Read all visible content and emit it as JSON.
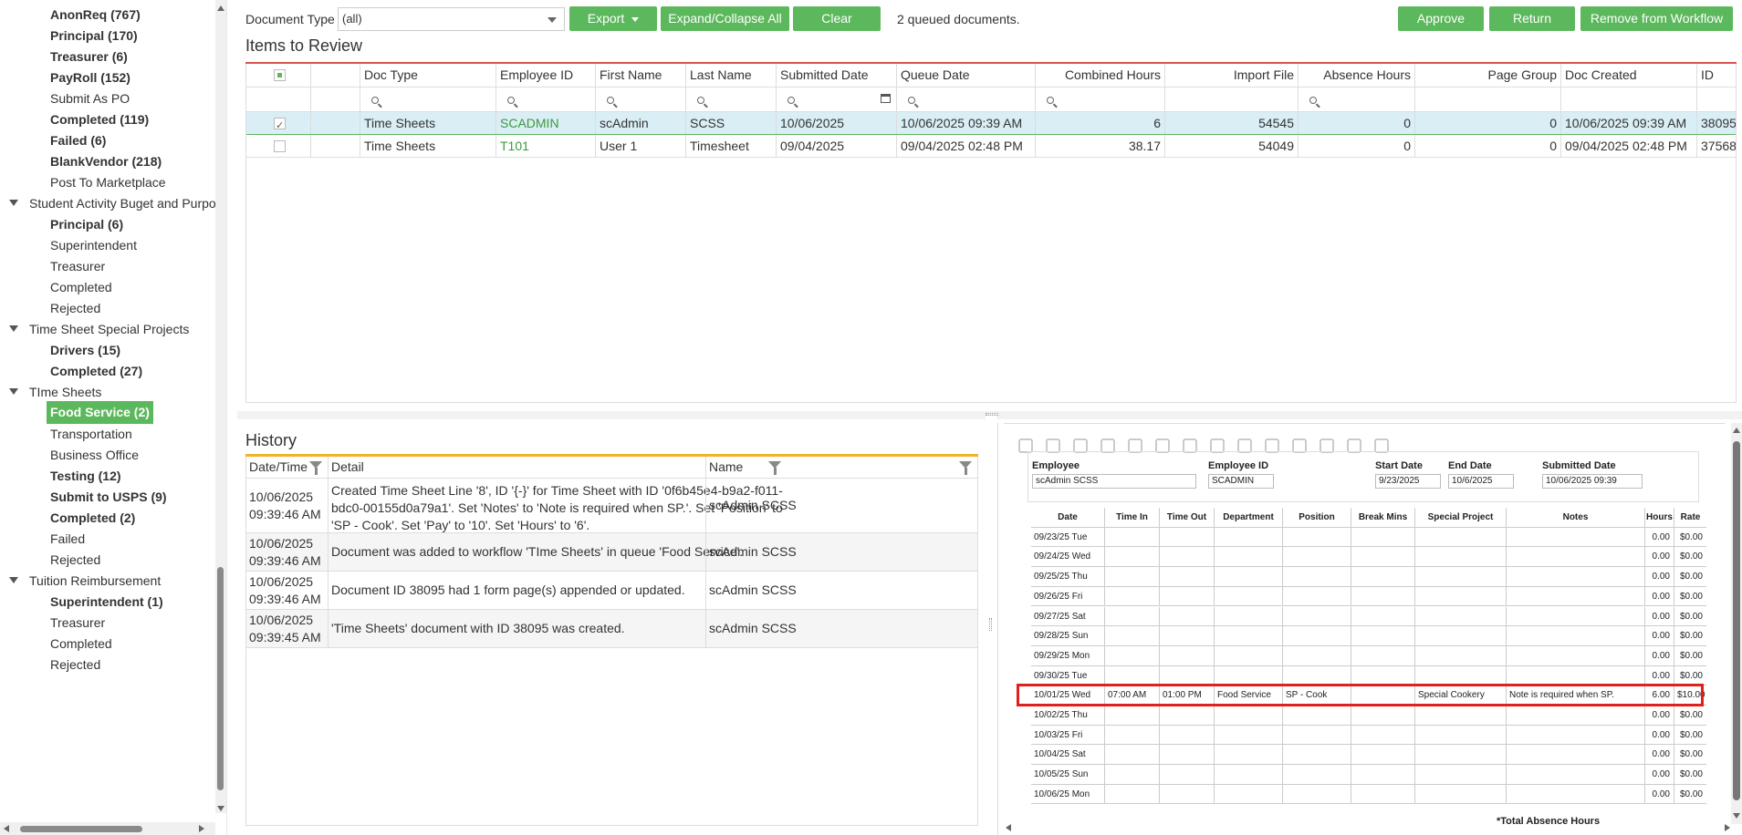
{
  "sidebar": {
    "items": [
      {
        "label": "AnonReq (767)",
        "level": 2,
        "bold": true
      },
      {
        "label": "Principal (170)",
        "level": 2,
        "bold": true
      },
      {
        "label": "Treasurer (6)",
        "level": 2,
        "bold": true
      },
      {
        "label": "PayRoll (152)",
        "level": 2,
        "bold": true
      },
      {
        "label": "Submit As PO",
        "level": 2,
        "bold": false
      },
      {
        "label": "Completed (119)",
        "level": 2,
        "bold": true
      },
      {
        "label": "Failed (6)",
        "level": 2,
        "bold": true
      },
      {
        "label": "BlankVendor (218)",
        "level": 2,
        "bold": true
      },
      {
        "label": "Post To Marketplace",
        "level": 2,
        "bold": false
      },
      {
        "label": "Student Activity Buget and Purpo",
        "level": 1,
        "bold": false
      },
      {
        "label": "Principal (6)",
        "level": 2,
        "bold": true
      },
      {
        "label": "Superintendent",
        "level": 2,
        "bold": false
      },
      {
        "label": "Treasurer",
        "level": 2,
        "bold": false
      },
      {
        "label": "Completed",
        "level": 2,
        "bold": false
      },
      {
        "label": "Rejected",
        "level": 2,
        "bold": false
      },
      {
        "label": "Time Sheet Special Projects",
        "level": 1,
        "bold": false
      },
      {
        "label": "Drivers (15)",
        "level": 2,
        "bold": true
      },
      {
        "label": "Completed (27)",
        "level": 2,
        "bold": true
      },
      {
        "label": "TIme Sheets",
        "level": 1,
        "bold": false
      },
      {
        "label": "Food Service (2)",
        "level": 2,
        "bold": true,
        "selected": true
      },
      {
        "label": "Transportation",
        "level": 2,
        "bold": false
      },
      {
        "label": "Business Office",
        "level": 2,
        "bold": false
      },
      {
        "label": "Testing (12)",
        "level": 2,
        "bold": true
      },
      {
        "label": "Submit to USPS (9)",
        "level": 2,
        "bold": true
      },
      {
        "label": "Completed (2)",
        "level": 2,
        "bold": true
      },
      {
        "label": "Failed",
        "level": 2,
        "bold": false
      },
      {
        "label": "Rejected",
        "level": 2,
        "bold": false
      },
      {
        "label": "Tuition Reimbursement",
        "level": 1,
        "bold": false
      },
      {
        "label": "Superintendent (1)",
        "level": 2,
        "bold": true
      },
      {
        "label": "Treasurer",
        "level": 2,
        "bold": false
      },
      {
        "label": "Completed",
        "level": 2,
        "bold": false
      },
      {
        "label": "Rejected",
        "level": 2,
        "bold": false
      }
    ]
  },
  "toolbar": {
    "doc_type_label": "Document Type",
    "doc_type_value": "(all)",
    "export_label": "Export",
    "expand_label": "Expand/Collapse All",
    "clear_label": "Clear",
    "queued_text": "2 queued documents.",
    "approve_label": "Approve",
    "return_label": "Return",
    "remove_label": "Remove from Workflow"
  },
  "items": {
    "title": "Items to Review",
    "columns": [
      "Doc Type",
      "Employee ID",
      "First Name",
      "Last Name",
      "Submitted Date",
      "Queue Date",
      "Combined Hours",
      "Import File",
      "Absence Hours",
      "Page Group",
      "Doc Created",
      "ID"
    ],
    "rows": [
      [
        "Time Sheets",
        "SCADMIN",
        "scAdmin",
        "SCSS",
        "10/06/2025",
        "10/06/2025 09:39 AM",
        "6",
        "54545",
        "0",
        "0",
        "10/06/2025 09:39 AM",
        "38095"
      ],
      [
        "Time Sheets",
        "T101",
        "User 1",
        "Timesheet",
        "09/04/2025",
        "09/04/2025 02:48 PM",
        "38.17",
        "54049",
        "0",
        "0",
        "09/04/2025 02:48 PM",
        "37568"
      ]
    ]
  },
  "history": {
    "title": "History",
    "columns": [
      "Date/Time",
      "Detail",
      "Name"
    ],
    "rows": [
      [
        "10/06/2025 09:39:46 AM",
        "Created Time Sheet Line '8', ID '{-}' for Time Sheet with ID '0f6b45e4-b9a2-f011-bdc0-00155d0a79a1'. Set 'Notes' to 'Note is required when SP.'. Set 'Position' to 'SP - Cook'. Set 'Pay' to '10'. Set 'Hours' to '6'.",
        "scAdmin SCSS"
      ],
      [
        "10/06/2025 09:39:46 AM",
        "Document was added to workflow 'TIme Sheets' in queue 'Food Service'.",
        "scAdmin SCSS"
      ],
      [
        "10/06/2025 09:39:46 AM",
        "Document ID 38095 had 1 form page(s) appended or updated.",
        "scAdmin SCSS"
      ],
      [
        "10/06/2025 09:39:45 AM",
        "'Time Sheets' document with ID 38095 was created.",
        "scAdmin SCSS"
      ]
    ]
  },
  "document": {
    "employee_label": "Employee",
    "employee_value": "scAdmin SCSS",
    "empid_label": "Employee ID",
    "empid_value": "SCADMIN",
    "start_label": "Start Date",
    "start_value": "9/23/2025",
    "end_label": "End Date",
    "end_value": "10/6/2025",
    "submitted_label": "Submitted Date",
    "submitted_value": "10/06/2025 09:39",
    "columns": [
      "Date",
      "Time In",
      "Time Out",
      "Department",
      "Position",
      "Break Mins",
      "Special Project",
      "Notes",
      "Hours",
      "Rate"
    ],
    "rows": [
      [
        "09/23/25 Tue",
        "",
        "",
        "",
        "",
        "",
        "",
        "",
        "0.00",
        "$0.00"
      ],
      [
        "09/24/25 Wed",
        "",
        "",
        "",
        "",
        "",
        "",
        "",
        "0.00",
        "$0.00"
      ],
      [
        "09/25/25 Thu",
        "",
        "",
        "",
        "",
        "",
        "",
        "",
        "0.00",
        "$0.00"
      ],
      [
        "09/26/25 Fri",
        "",
        "",
        "",
        "",
        "",
        "",
        "",
        "0.00",
        "$0.00"
      ],
      [
        "09/27/25 Sat",
        "",
        "",
        "",
        "",
        "",
        "",
        "",
        "0.00",
        "$0.00"
      ],
      [
        "09/28/25 Sun",
        "",
        "",
        "",
        "",
        "",
        "",
        "",
        "0.00",
        "$0.00"
      ],
      [
        "09/29/25 Mon",
        "",
        "",
        "",
        "",
        "",
        "",
        "",
        "0.00",
        "$0.00"
      ],
      [
        "09/30/25 Tue",
        "",
        "",
        "",
        "",
        "",
        "",
        "",
        "0.00",
        "$0.00"
      ],
      [
        "10/01/25 Wed",
        "07:00 AM",
        "01:00 PM",
        "Food Service",
        "SP - Cook",
        "",
        "Special Cookery",
        "Note is required when SP.",
        "6.00",
        "$10.00"
      ],
      [
        "10/02/25 Thu",
        "",
        "",
        "",
        "",
        "",
        "",
        "",
        "0.00",
        "$0.00"
      ],
      [
        "10/03/25 Fri",
        "",
        "",
        "",
        "",
        "",
        "",
        "",
        "0.00",
        "$0.00"
      ],
      [
        "10/04/25 Sat",
        "",
        "",
        "",
        "",
        "",
        "",
        "",
        "0.00",
        "$0.00"
      ],
      [
        "10/05/25 Sun",
        "",
        "",
        "",
        "",
        "",
        "",
        "",
        "0.00",
        "$0.00"
      ],
      [
        "10/06/25 Mon",
        "",
        "",
        "",
        "",
        "",
        "",
        "",
        "0.00",
        "$0.00"
      ]
    ],
    "total_label": "*Total Absence Hours"
  },
  "colors": {
    "accent_green": "#5cb85c",
    "items_line": "#d9534f",
    "history_line": "#f0b429",
    "highlight": "#e0201c"
  }
}
